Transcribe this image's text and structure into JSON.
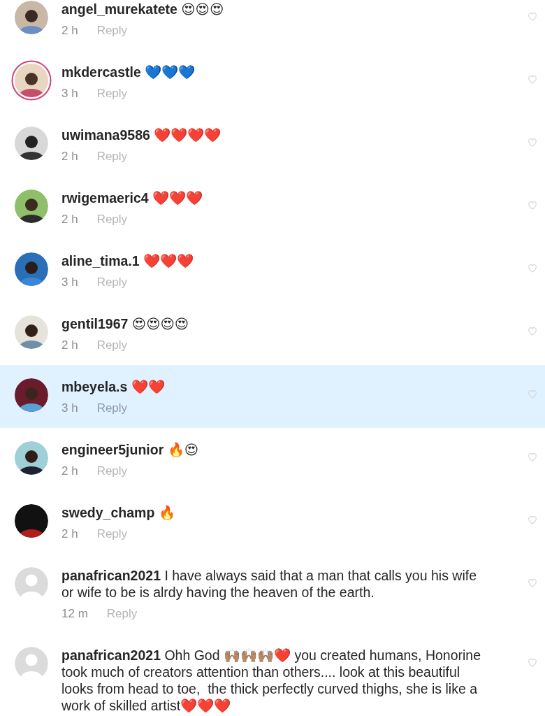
{
  "comments": [
    {
      "username": "angel_murekatete",
      "text": "😍😍😍",
      "time": "2 h",
      "reply": "Reply",
      "story_ring": false,
      "highlighted": false
    },
    {
      "username": "mkdercastle",
      "text": "💙💙💙",
      "time": "3 h",
      "reply": "Reply",
      "story_ring": true,
      "highlighted": false
    },
    {
      "username": "uwimana9586",
      "text": "❤️❤️❤️❤️",
      "time": "2 h",
      "reply": "Reply",
      "story_ring": false,
      "highlighted": false
    },
    {
      "username": "rwigemaeric4",
      "text": "❤️❤️❤️",
      "time": "2 h",
      "reply": "Reply",
      "story_ring": false,
      "highlighted": false
    },
    {
      "username": "aline_tima.1",
      "text": "❤️❤️❤️",
      "time": "3 h",
      "reply": "Reply",
      "story_ring": false,
      "highlighted": false
    },
    {
      "username": "gentil1967",
      "text": "😍😍😍😍",
      "time": "2 h",
      "reply": "Reply",
      "story_ring": false,
      "highlighted": false
    },
    {
      "username": "mbeyela.s",
      "text": "❤️❤️",
      "time": "3 h",
      "reply": "Reply",
      "story_ring": false,
      "highlighted": true
    },
    {
      "username": "engineer5junior",
      "text": "🔥😍",
      "time": "2 h",
      "reply": "Reply",
      "story_ring": false,
      "highlighted": false
    },
    {
      "username": "swedy_champ",
      "text": "🔥",
      "time": "2 h",
      "reply": "Reply",
      "story_ring": false,
      "highlighted": false
    },
    {
      "username": "panafrican2021",
      "text": "I have always said that a man that calls you his wife or wife to be is alrdy having the heaven of the earth.",
      "time": "12 m",
      "reply": "Reply",
      "avatar": {
        "kind": "default"
      },
      "story_ring": false,
      "highlighted": false
    },
    {
      "username": "panafrican2021",
      "text": "Ohh God 🙌🏽🙌🏽🙌🏽❤️ you created humans, Honorine took much of creators attention than others.... look at this beautiful looks from head to toe,  the thick perfectly curved thighs, she is like a work of skilled artist❤️❤️❤️",
      "avatar": {
        "kind": "default"
      },
      "story_ring": false,
      "highlighted": false
    }
  ]
}
